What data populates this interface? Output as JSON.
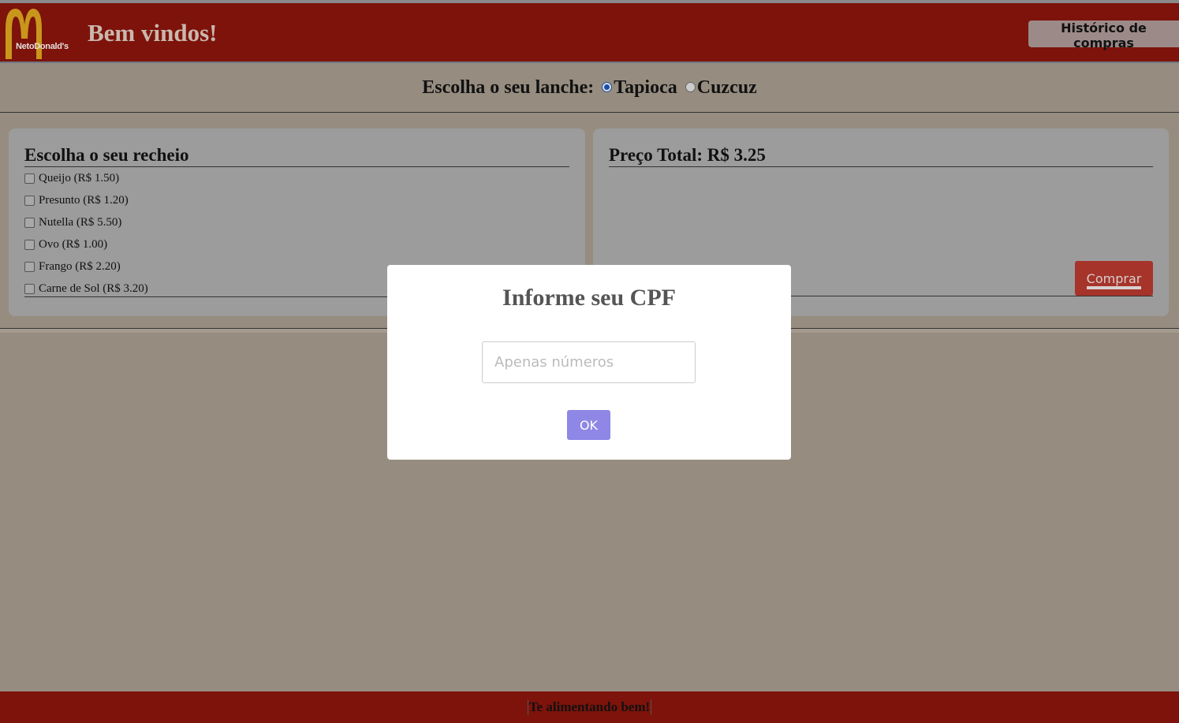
{
  "header": {
    "logo_text": "NetoDonald's",
    "welcome": "Bem vindos!",
    "history_button": "Histórico de compras"
  },
  "choice": {
    "label": "Escolha o seu lanche:",
    "options": [
      "Tapioca",
      "Cuzcuz"
    ],
    "selected": "Tapioca"
  },
  "fillings": {
    "title": "Escolha o seu recheio",
    "items": [
      {
        "label": "Queijo (R$ 1.50)",
        "checked": false
      },
      {
        "label": "Presunto (R$ 1.20)",
        "checked": false
      },
      {
        "label": "Nutella (R$ 5.50)",
        "checked": false
      },
      {
        "label": "Ovo (R$ 1.00)",
        "checked": false
      },
      {
        "label": "Frango (R$ 2.20)",
        "checked": false
      },
      {
        "label": "Carne de Sol (R$ 3.20)",
        "checked": false
      }
    ]
  },
  "summary": {
    "total": "Preço Total: R$ 3.25",
    "buy_button": "Comprar"
  },
  "modal": {
    "title": "Informe seu CPF",
    "placeholder": "Apenas números",
    "value": "",
    "ok_button": "OK"
  },
  "footer": {
    "text": "Te alimentando bem!"
  },
  "colors": {
    "brand_red": "#7d130b",
    "logo_gold": "#c9961c",
    "ok_purple": "#8e87e6",
    "buy_red": "#a6342a"
  }
}
